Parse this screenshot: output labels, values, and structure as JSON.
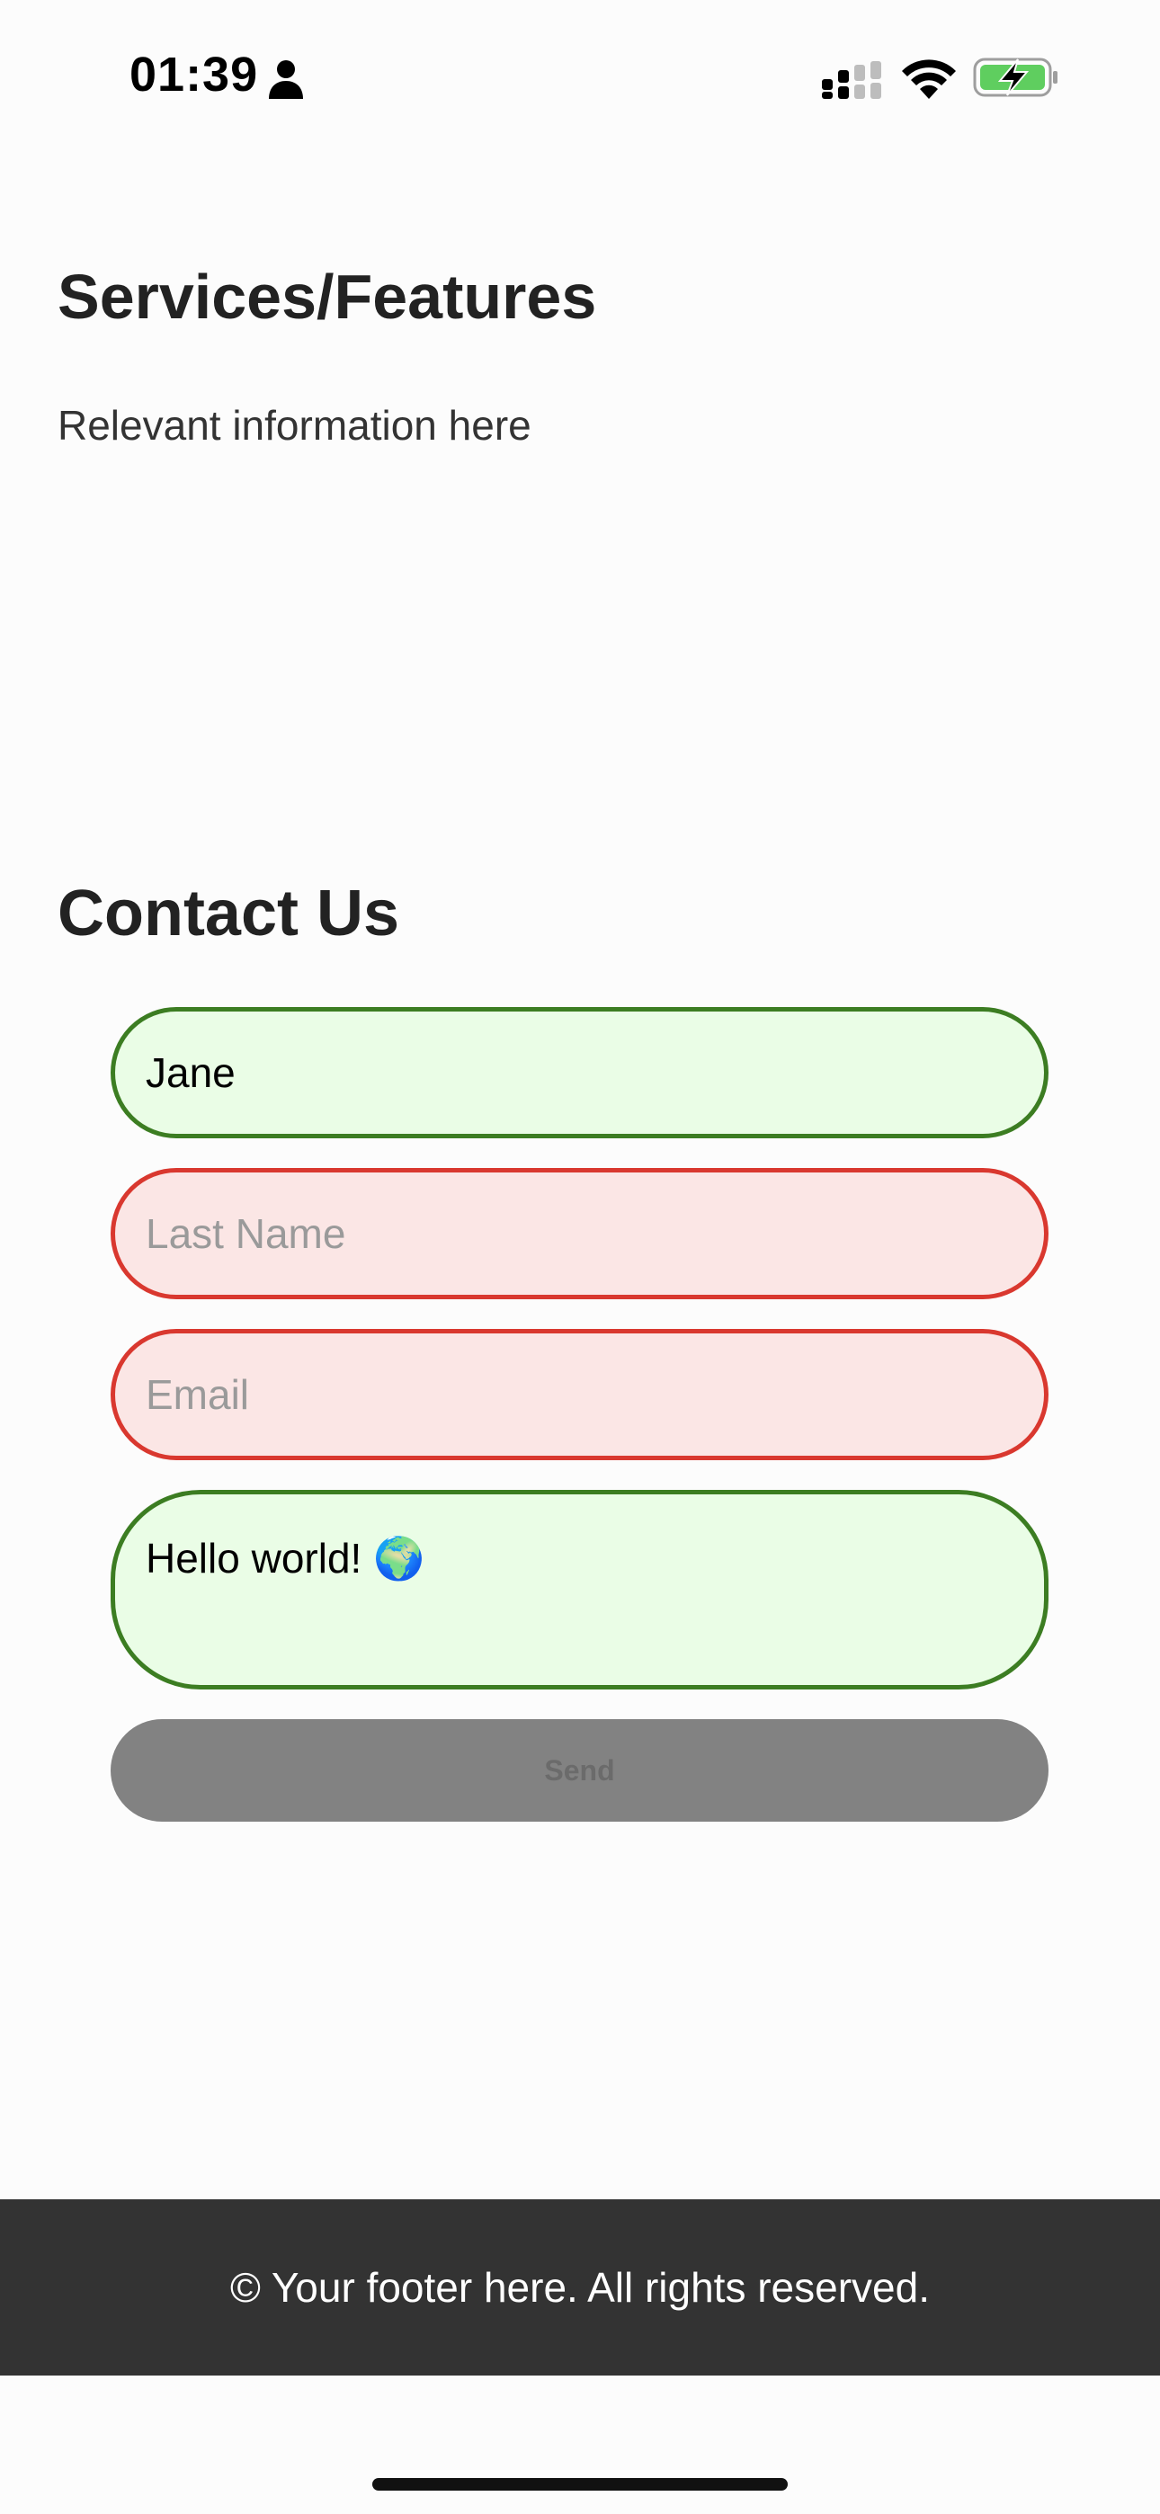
{
  "status_bar": {
    "time": "01:39",
    "person_icon": "person-icon",
    "signal_icon": "cellular-signal-icon",
    "wifi_icon": "wifi-icon",
    "battery_icon": "battery-charging-icon"
  },
  "services": {
    "title": "Services/Features",
    "text": "Relevant information here"
  },
  "contact": {
    "title": "Contact Us",
    "first_name": {
      "value": "Jane",
      "placeholder": "",
      "state": "valid"
    },
    "last_name": {
      "value": "",
      "placeholder": "Last Name",
      "state": "invalid"
    },
    "email": {
      "value": "",
      "placeholder": "Email",
      "state": "invalid"
    },
    "message": {
      "value": "Hello world! 🌍",
      "placeholder": "",
      "state": "valid"
    },
    "send_label": "Send"
  },
  "footer": {
    "text": "© Your footer here. All rights reserved."
  },
  "colors": {
    "valid_bg": "#eafde6",
    "valid_border": "#3c7d22",
    "invalid_bg": "#fbe6e5",
    "invalid_border": "#d9382f",
    "button_bg": "#828282",
    "footer_bg": "#333333",
    "battery_green": "#5fce5f"
  }
}
